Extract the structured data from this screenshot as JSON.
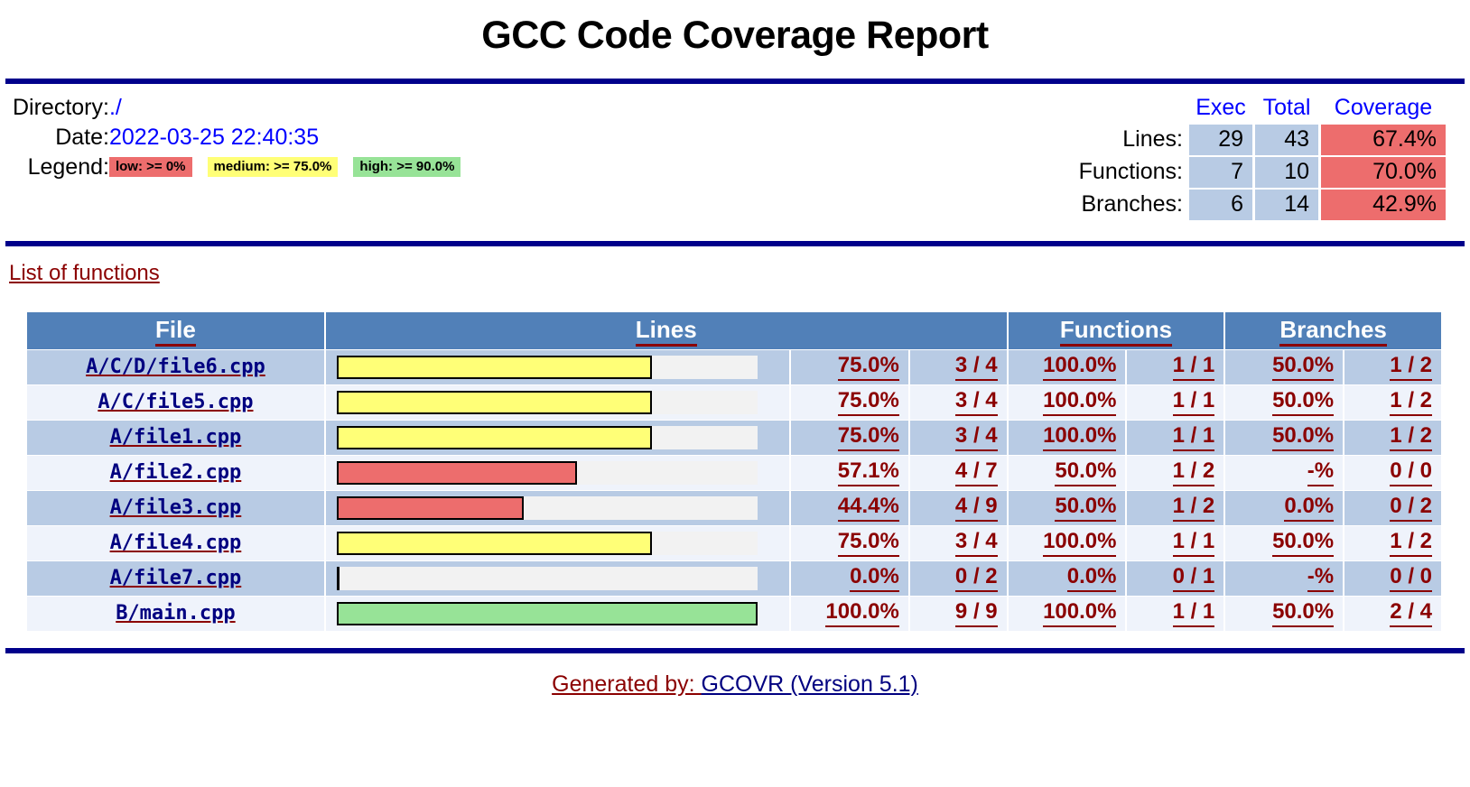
{
  "title": "GCC Code Coverage Report",
  "meta": {
    "directory_label": "Directory:",
    "directory_value": "./",
    "date_label": "Date:",
    "date_value": "2022-03-25 22:40:35",
    "legend_label": "Legend:",
    "legend": [
      {
        "text": "low: >= 0%",
        "class": "chip-low",
        "color": "#ed6d6d"
      },
      {
        "text": "medium: >= 75.0%",
        "class": "chip-medium",
        "color": "#ffff77"
      },
      {
        "text": "high: >= 90.0%",
        "class": "chip-high",
        "color": "#97e397"
      }
    ]
  },
  "summary": {
    "headers": {
      "exec": "Exec",
      "total": "Total",
      "coverage": "Coverage"
    },
    "rows": [
      {
        "label": "Lines:",
        "exec": "29",
        "total": "43",
        "coverage": "67.4%",
        "cov_class": "cov-low"
      },
      {
        "label": "Functions:",
        "exec": "7",
        "total": "10",
        "coverage": "70.0%",
        "cov_class": "cov-low"
      },
      {
        "label": "Branches:",
        "exec": "6",
        "total": "14",
        "coverage": "42.9%",
        "cov_class": "cov-low"
      }
    ]
  },
  "links": {
    "functions_list": "List of functions"
  },
  "table": {
    "headers": {
      "file": "File",
      "lines": "Lines",
      "functions": "Functions",
      "branches": "Branches"
    },
    "rows": [
      {
        "file": "A/C/D/file6.cpp",
        "bar_pct": 75.0,
        "bar_class": "fill-medium",
        "lines_pct": "75.0%",
        "lines_frac": "3 / 4",
        "func_pct": "100.0%",
        "func_frac": "1 / 1",
        "branch_pct": "50.0%",
        "branch_frac": "1 / 2"
      },
      {
        "file": "A/C/file5.cpp",
        "bar_pct": 75.0,
        "bar_class": "fill-medium",
        "lines_pct": "75.0%",
        "lines_frac": "3 / 4",
        "func_pct": "100.0%",
        "func_frac": "1 / 1",
        "branch_pct": "50.0%",
        "branch_frac": "1 / 2"
      },
      {
        "file": "A/file1.cpp",
        "bar_pct": 75.0,
        "bar_class": "fill-medium",
        "lines_pct": "75.0%",
        "lines_frac": "3 / 4",
        "func_pct": "100.0%",
        "func_frac": "1 / 1",
        "branch_pct": "50.0%",
        "branch_frac": "1 / 2"
      },
      {
        "file": "A/file2.cpp",
        "bar_pct": 57.1,
        "bar_class": "fill-low",
        "lines_pct": "57.1%",
        "lines_frac": "4 / 7",
        "func_pct": "50.0%",
        "func_frac": "1 / 2",
        "branch_pct": "-%",
        "branch_frac": "0 / 0"
      },
      {
        "file": "A/file3.cpp",
        "bar_pct": 44.4,
        "bar_class": "fill-low",
        "lines_pct": "44.4%",
        "lines_frac": "4 / 9",
        "func_pct": "50.0%",
        "func_frac": "1 / 2",
        "branch_pct": "0.0%",
        "branch_frac": "0 / 2"
      },
      {
        "file": "A/file4.cpp",
        "bar_pct": 75.0,
        "bar_class": "fill-medium",
        "lines_pct": "75.0%",
        "lines_frac": "3 / 4",
        "func_pct": "100.0%",
        "func_frac": "1 / 1",
        "branch_pct": "50.0%",
        "branch_frac": "1 / 2"
      },
      {
        "file": "A/file7.cpp",
        "bar_pct": 0.0,
        "bar_class": "fill-zero",
        "lines_pct": "0.0%",
        "lines_frac": "0 / 2",
        "func_pct": "0.0%",
        "func_frac": "0 / 1",
        "branch_pct": "-%",
        "branch_frac": "0 / 0"
      },
      {
        "file": "B/main.cpp",
        "bar_pct": 100.0,
        "bar_class": "fill-high",
        "lines_pct": "100.0%",
        "lines_frac": "9 / 9",
        "func_pct": "100.0%",
        "func_frac": "1 / 1",
        "branch_pct": "50.0%",
        "branch_frac": "2 / 4"
      }
    ]
  },
  "footer": {
    "generated_by": "Generated by: ",
    "tool": "GCOVR (Version 5.1)"
  },
  "colors": {
    "header_blue": "#5180b8",
    "row_odd": "#b8cbe4",
    "row_even": "#eff3fb",
    "rule": "#00008b",
    "link_dark_red": "#8b0000",
    "link_blue": "#000080",
    "value_blue": "#0000ff"
  }
}
